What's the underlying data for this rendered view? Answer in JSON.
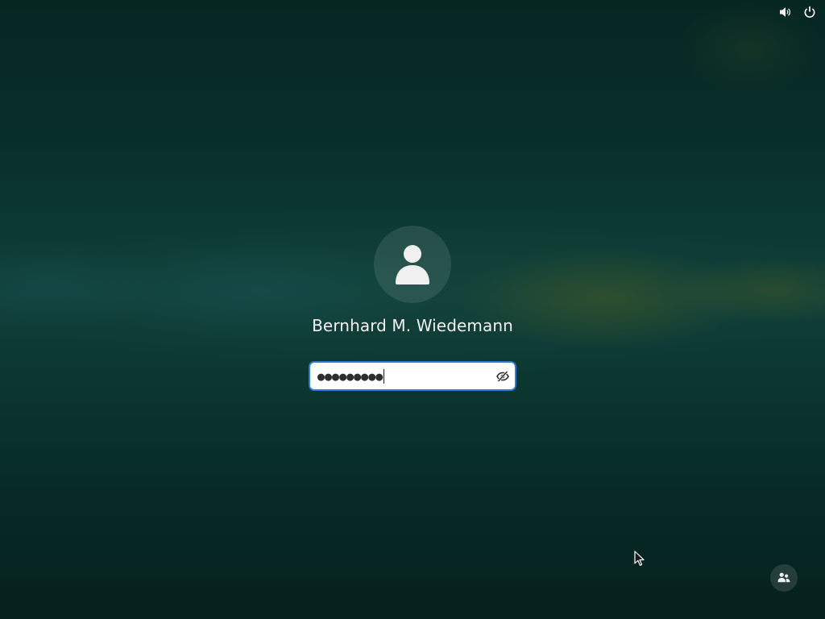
{
  "top_bar": {
    "icons": [
      "volume-icon",
      "power-icon"
    ]
  },
  "login": {
    "avatar_icon": "person-icon",
    "user_name": "Bernhard M. Wiedemann",
    "password_value": "●●●●●●●●●",
    "reveal_icon": "eye-slash-icon",
    "field_border_color": "#2b7cd6"
  },
  "bottom": {
    "switch_user_icon": "switch-user-icon"
  },
  "cursor": {
    "icon": "mouse-pointer-icon"
  }
}
